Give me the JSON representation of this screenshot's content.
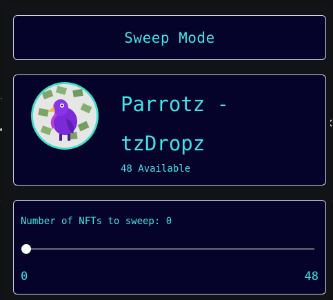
{
  "header": {
    "title": "Sweep Mode"
  },
  "collection": {
    "name": "Parrotz - tzDropz",
    "available_text": "48 Available",
    "avatar_icon": "parrot-avatar-icon"
  },
  "sweep": {
    "label": "Number of NFTs to sweep: 0",
    "value": 0,
    "min_label": "0",
    "max_label": "48"
  },
  "background": {
    "left_fragment": "t",
    "right_icon": "close-icon"
  },
  "colors": {
    "accent": "#43e2e6",
    "card_bg": "#06032a",
    "card_border": "#cfd6e6",
    "avatar_ring": "#3fe0c8"
  }
}
